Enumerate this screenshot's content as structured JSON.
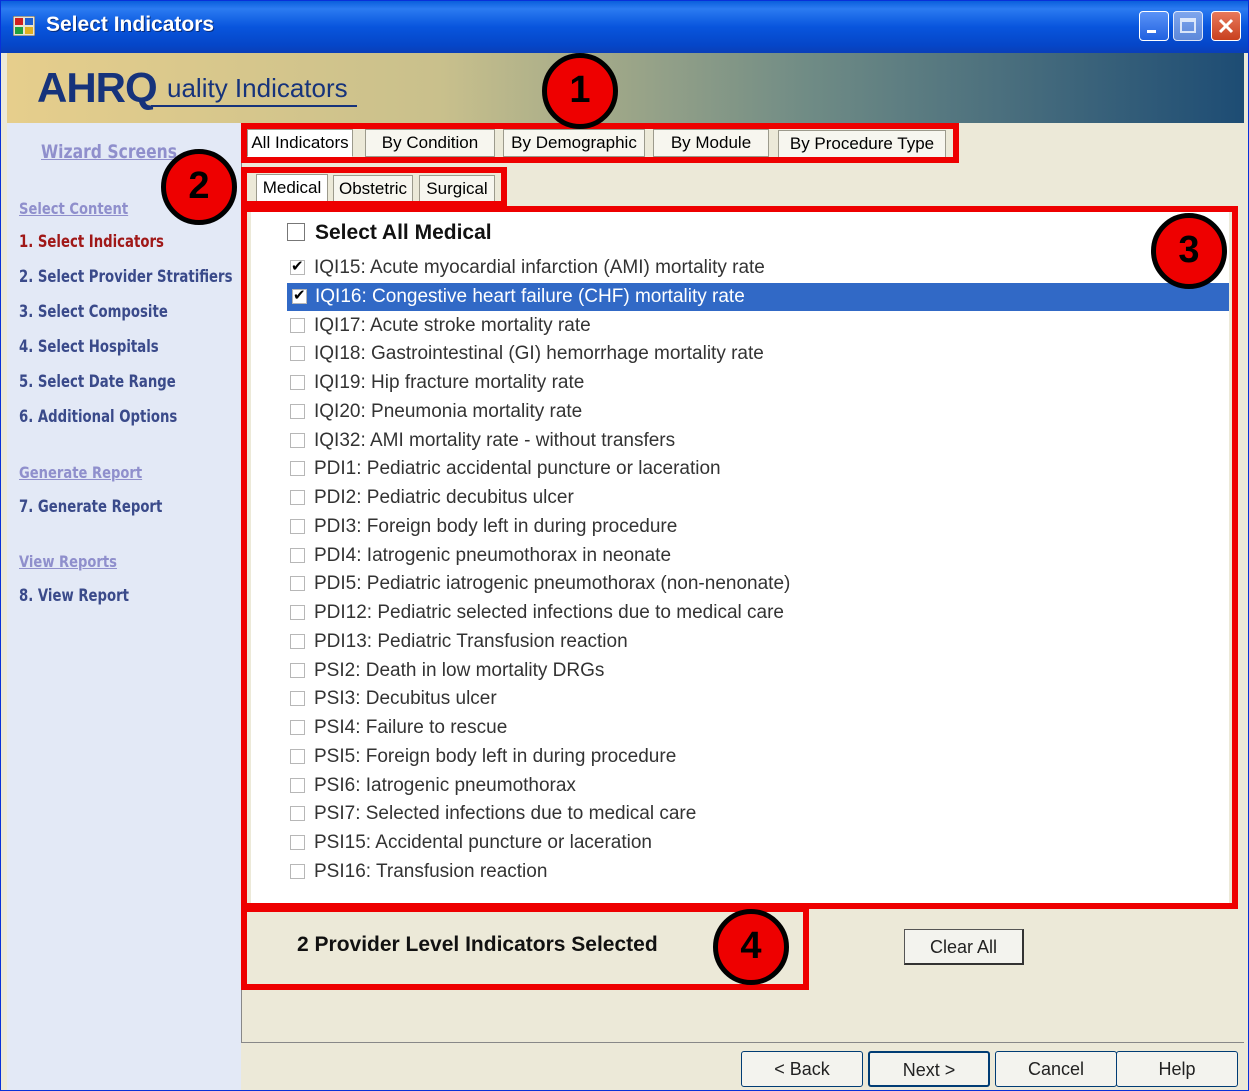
{
  "window": {
    "title": "Select Indicators"
  },
  "banner": {
    "logo_main": "AHRQ",
    "logo_sub": "uality Indicators"
  },
  "sidebar": {
    "wizard_heading": "Wizard Screens",
    "sections": [
      {
        "heading": "Select Content",
        "items": [
          "1. Select Indicators",
          "2. Select Provider Stratifiers",
          "3. Select Composite",
          "4. Select Hospitals",
          "5. Select Date Range",
          "6. Additional Options"
        ]
      },
      {
        "heading": "Generate Report",
        "items": [
          "7. Generate Report"
        ]
      },
      {
        "heading": "View Reports",
        "items": [
          "8. View Report"
        ]
      }
    ]
  },
  "top_tabs": [
    "All Indicators",
    "By Condition",
    "By Demographic",
    "By Module",
    "By Procedure Type"
  ],
  "sub_tabs": [
    "Medical",
    "Obstetric",
    "Surgical"
  ],
  "select_all_label": "Select All Medical",
  "indicators": [
    {
      "label": "IQI15: Acute myocardial infarction (AMI) mortality rate",
      "checked": true
    },
    {
      "label": "IQI16: Congestive heart failure (CHF) mortality rate",
      "checked": true,
      "selected": true
    },
    {
      "label": "IQI17: Acute stroke mortality rate",
      "checked": false
    },
    {
      "label": "IQI18: Gastrointestinal (GI) hemorrhage mortality rate",
      "checked": false
    },
    {
      "label": "IQI19: Hip fracture mortality rate",
      "checked": false
    },
    {
      "label": "IQI20: Pneumonia mortality rate",
      "checked": false
    },
    {
      "label": "IQI32: AMI mortality rate - without transfers",
      "checked": false
    },
    {
      "label": "PDI1: Pediatric accidental puncture or laceration",
      "checked": false
    },
    {
      "label": "PDI2: Pediatric decubitus ulcer",
      "checked": false
    },
    {
      "label": "PDI3: Foreign body left in during procedure",
      "checked": false
    },
    {
      "label": "PDI4: Iatrogenic pneumothorax in neonate",
      "checked": false
    },
    {
      "label": "PDI5: Pediatric iatrogenic pneumothorax (non-nenonate)",
      "checked": false
    },
    {
      "label": "PDI12: Pediatric selected infections due to medical care",
      "checked": false
    },
    {
      "label": "PDI13: Pediatric Transfusion reaction",
      "checked": false
    },
    {
      "label": "PSI2: Death in low mortality DRGs",
      "checked": false
    },
    {
      "label": "PSI3: Decubitus ulcer",
      "checked": false
    },
    {
      "label": "PSI4: Failure to rescue",
      "checked": false
    },
    {
      "label": "PSI5: Foreign body left in during procedure",
      "checked": false
    },
    {
      "label": "PSI6: Iatrogenic pneumothorax",
      "checked": false
    },
    {
      "label": "PSI7: Selected infections due to medical care",
      "checked": false
    },
    {
      "label": "PSI15: Accidental puncture or laceration",
      "checked": false
    },
    {
      "label": "PSI16: Transfusion reaction",
      "checked": false
    }
  ],
  "status_text": "2  Provider Level Indicators Selected",
  "buttons": {
    "clear_all": "Clear All",
    "back": "< Back",
    "next": "Next >",
    "cancel": "Cancel",
    "help": "Help"
  },
  "markers": [
    "1",
    "2",
    "3",
    "4"
  ],
  "colors": {
    "highlight": "#e00000",
    "selection": "#3169c6",
    "active_step": "#a01818"
  }
}
